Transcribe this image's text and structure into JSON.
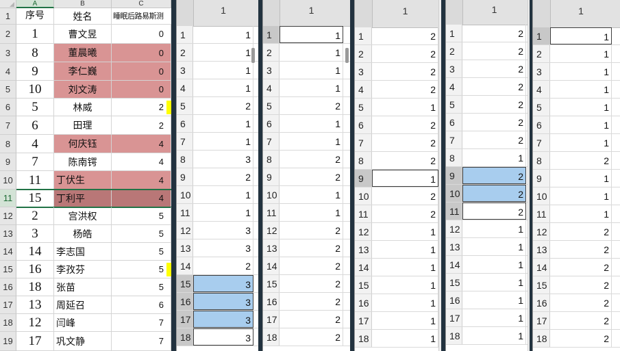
{
  "main_sheet": {
    "col_letters": [
      "A",
      "B",
      "C"
    ],
    "headers": [
      "序号",
      "姓名",
      "睡眠后路易斯测"
    ],
    "rows": [
      {
        "rownum": "2",
        "seq": "1",
        "name": "曹文昱",
        "val": "0",
        "style": "",
        "align": "center"
      },
      {
        "rownum": "3",
        "seq": "8",
        "name": "董晨曦",
        "val": "0",
        "style": "pink",
        "align": "center"
      },
      {
        "rownum": "4",
        "seq": "9",
        "name": "李仁巍",
        "val": "0",
        "style": "pink",
        "align": "center"
      },
      {
        "rownum": "5",
        "seq": "10",
        "name": "刘文涛",
        "val": "0",
        "style": "pink",
        "align": "center"
      },
      {
        "rownum": "6",
        "seq": "5",
        "name": "林威",
        "val": "2",
        "style": "",
        "align": "center",
        "mark": "yellow"
      },
      {
        "rownum": "7",
        "seq": "6",
        "name": "田理",
        "val": "2",
        "style": "",
        "align": "center"
      },
      {
        "rownum": "8",
        "seq": "4",
        "name": "何庆钰",
        "val": "4",
        "style": "pink",
        "align": "center"
      },
      {
        "rownum": "9",
        "seq": "7",
        "name": "陈南锷",
        "val": "4",
        "style": "",
        "align": "center"
      },
      {
        "rownum": "10",
        "seq": "11",
        "name": "丁伏生",
        "val": "4",
        "style": "pink",
        "align": "left"
      },
      {
        "rownum": "11",
        "seq": "15",
        "name": "丁利平",
        "val": "4",
        "style": "darkpink",
        "align": "left",
        "selected": true
      },
      {
        "rownum": "12",
        "seq": "2",
        "name": "宫洪权",
        "val": "5",
        "style": "",
        "align": "center"
      },
      {
        "rownum": "13",
        "seq": "3",
        "name": "杨皓",
        "val": "5",
        "style": "",
        "align": "center"
      },
      {
        "rownum": "14",
        "seq": "14",
        "name": "李志国",
        "val": "5",
        "style": "",
        "align": "left"
      },
      {
        "rownum": "15",
        "seq": "16",
        "name": "李孜芬",
        "val": "5",
        "style": "",
        "align": "left",
        "mark": "yellow"
      },
      {
        "rownum": "16",
        "seq": "18",
        "name": "张苗",
        "val": "5",
        "style": "",
        "align": "left"
      },
      {
        "rownum": "17",
        "seq": "13",
        "name": "周延召",
        "val": "6",
        "style": "",
        "align": "left"
      },
      {
        "rownum": "18",
        "seq": "12",
        "name": "闫峰",
        "val": "7",
        "style": "",
        "align": "left"
      },
      {
        "rownum": "19",
        "seq": "17",
        "name": "巩文静",
        "val": "7",
        "style": "",
        "align": "left"
      }
    ]
  },
  "mini_sheets": [
    {
      "header": "1",
      "rows": [
        {
          "n": "1",
          "v": "1"
        },
        {
          "n": "2",
          "v": "1"
        },
        {
          "n": "3",
          "v": "1"
        },
        {
          "n": "4",
          "v": "1"
        },
        {
          "n": "5",
          "v": "2"
        },
        {
          "n": "6",
          "v": "1"
        },
        {
          "n": "7",
          "v": "1"
        },
        {
          "n": "8",
          "v": "3"
        },
        {
          "n": "9",
          "v": "2"
        },
        {
          "n": "10",
          "v": "1"
        },
        {
          "n": "11",
          "v": "1"
        },
        {
          "n": "12",
          "v": "3"
        },
        {
          "n": "13",
          "v": "3"
        },
        {
          "n": "14",
          "v": "2"
        },
        {
          "n": "15",
          "v": "3",
          "state": "hl",
          "rowsel": true
        },
        {
          "n": "16",
          "v": "3",
          "state": "hl",
          "rowsel": true
        },
        {
          "n": "17",
          "v": "3",
          "state": "hl",
          "rowsel": true
        },
        {
          "n": "18",
          "v": "3",
          "state": "box",
          "rowsel": true
        }
      ]
    },
    {
      "header": "1",
      "rows": [
        {
          "n": "1",
          "v": "1",
          "state": "box",
          "rowsel": true
        },
        {
          "n": "2",
          "v": "1"
        },
        {
          "n": "3",
          "v": "1"
        },
        {
          "n": "4",
          "v": "1"
        },
        {
          "n": "5",
          "v": "2"
        },
        {
          "n": "6",
          "v": "1"
        },
        {
          "n": "7",
          "v": "1"
        },
        {
          "n": "8",
          "v": "2"
        },
        {
          "n": "9",
          "v": "2"
        },
        {
          "n": "10",
          "v": "1"
        },
        {
          "n": "11",
          "v": "1"
        },
        {
          "n": "12",
          "v": "2"
        },
        {
          "n": "13",
          "v": "2"
        },
        {
          "n": "14",
          "v": "2"
        },
        {
          "n": "15",
          "v": "2"
        },
        {
          "n": "16",
          "v": "2"
        },
        {
          "n": "17",
          "v": "2"
        },
        {
          "n": "18",
          "v": "2"
        }
      ]
    },
    {
      "header": "1",
      "rows": [
        {
          "n": "1",
          "v": "2"
        },
        {
          "n": "2",
          "v": "2"
        },
        {
          "n": "3",
          "v": "2"
        },
        {
          "n": "4",
          "v": "2"
        },
        {
          "n": "5",
          "v": "1"
        },
        {
          "n": "6",
          "v": "2"
        },
        {
          "n": "7",
          "v": "2"
        },
        {
          "n": "8",
          "v": "2"
        },
        {
          "n": "9",
          "v": "1",
          "state": "box",
          "rowsel": true
        },
        {
          "n": "10",
          "v": "2"
        },
        {
          "n": "11",
          "v": "2"
        },
        {
          "n": "12",
          "v": "1"
        },
        {
          "n": "13",
          "v": "1"
        },
        {
          "n": "14",
          "v": "1"
        },
        {
          "n": "15",
          "v": "1"
        },
        {
          "n": "16",
          "v": "1"
        },
        {
          "n": "17",
          "v": "1"
        },
        {
          "n": "18",
          "v": "1"
        }
      ]
    },
    {
      "header": "1",
      "rows": [
        {
          "n": "1",
          "v": "2"
        },
        {
          "n": "2",
          "v": "2"
        },
        {
          "n": "3",
          "v": "2"
        },
        {
          "n": "4",
          "v": "2"
        },
        {
          "n": "5",
          "v": "2"
        },
        {
          "n": "6",
          "v": "2"
        },
        {
          "n": "7",
          "v": "2"
        },
        {
          "n": "8",
          "v": "1"
        },
        {
          "n": "9",
          "v": "2",
          "state": "hl",
          "rowsel": true
        },
        {
          "n": "10",
          "v": "2",
          "state": "hl",
          "rowsel": true
        },
        {
          "n": "11",
          "v": "2",
          "state": "box",
          "rowsel": true
        },
        {
          "n": "12",
          "v": "1"
        },
        {
          "n": "13",
          "v": "1"
        },
        {
          "n": "14",
          "v": "1"
        },
        {
          "n": "15",
          "v": "1"
        },
        {
          "n": "16",
          "v": "1"
        },
        {
          "n": "17",
          "v": "1"
        },
        {
          "n": "18",
          "v": "1"
        }
      ]
    },
    {
      "header": "1",
      "rows": [
        {
          "n": "1",
          "v": "1",
          "state": "box",
          "rowsel": true
        },
        {
          "n": "2",
          "v": "1"
        },
        {
          "n": "3",
          "v": "1"
        },
        {
          "n": "4",
          "v": "1"
        },
        {
          "n": "5",
          "v": "1"
        },
        {
          "n": "6",
          "v": "1"
        },
        {
          "n": "7",
          "v": "1"
        },
        {
          "n": "8",
          "v": "2"
        },
        {
          "n": "9",
          "v": "1"
        },
        {
          "n": "10",
          "v": "1"
        },
        {
          "n": "11",
          "v": "1"
        },
        {
          "n": "12",
          "v": "2"
        },
        {
          "n": "13",
          "v": "2"
        },
        {
          "n": "14",
          "v": "2"
        },
        {
          "n": "15",
          "v": "2"
        },
        {
          "n": "16",
          "v": "2"
        },
        {
          "n": "17",
          "v": "2"
        },
        {
          "n": "18",
          "v": "2"
        }
      ]
    }
  ]
}
